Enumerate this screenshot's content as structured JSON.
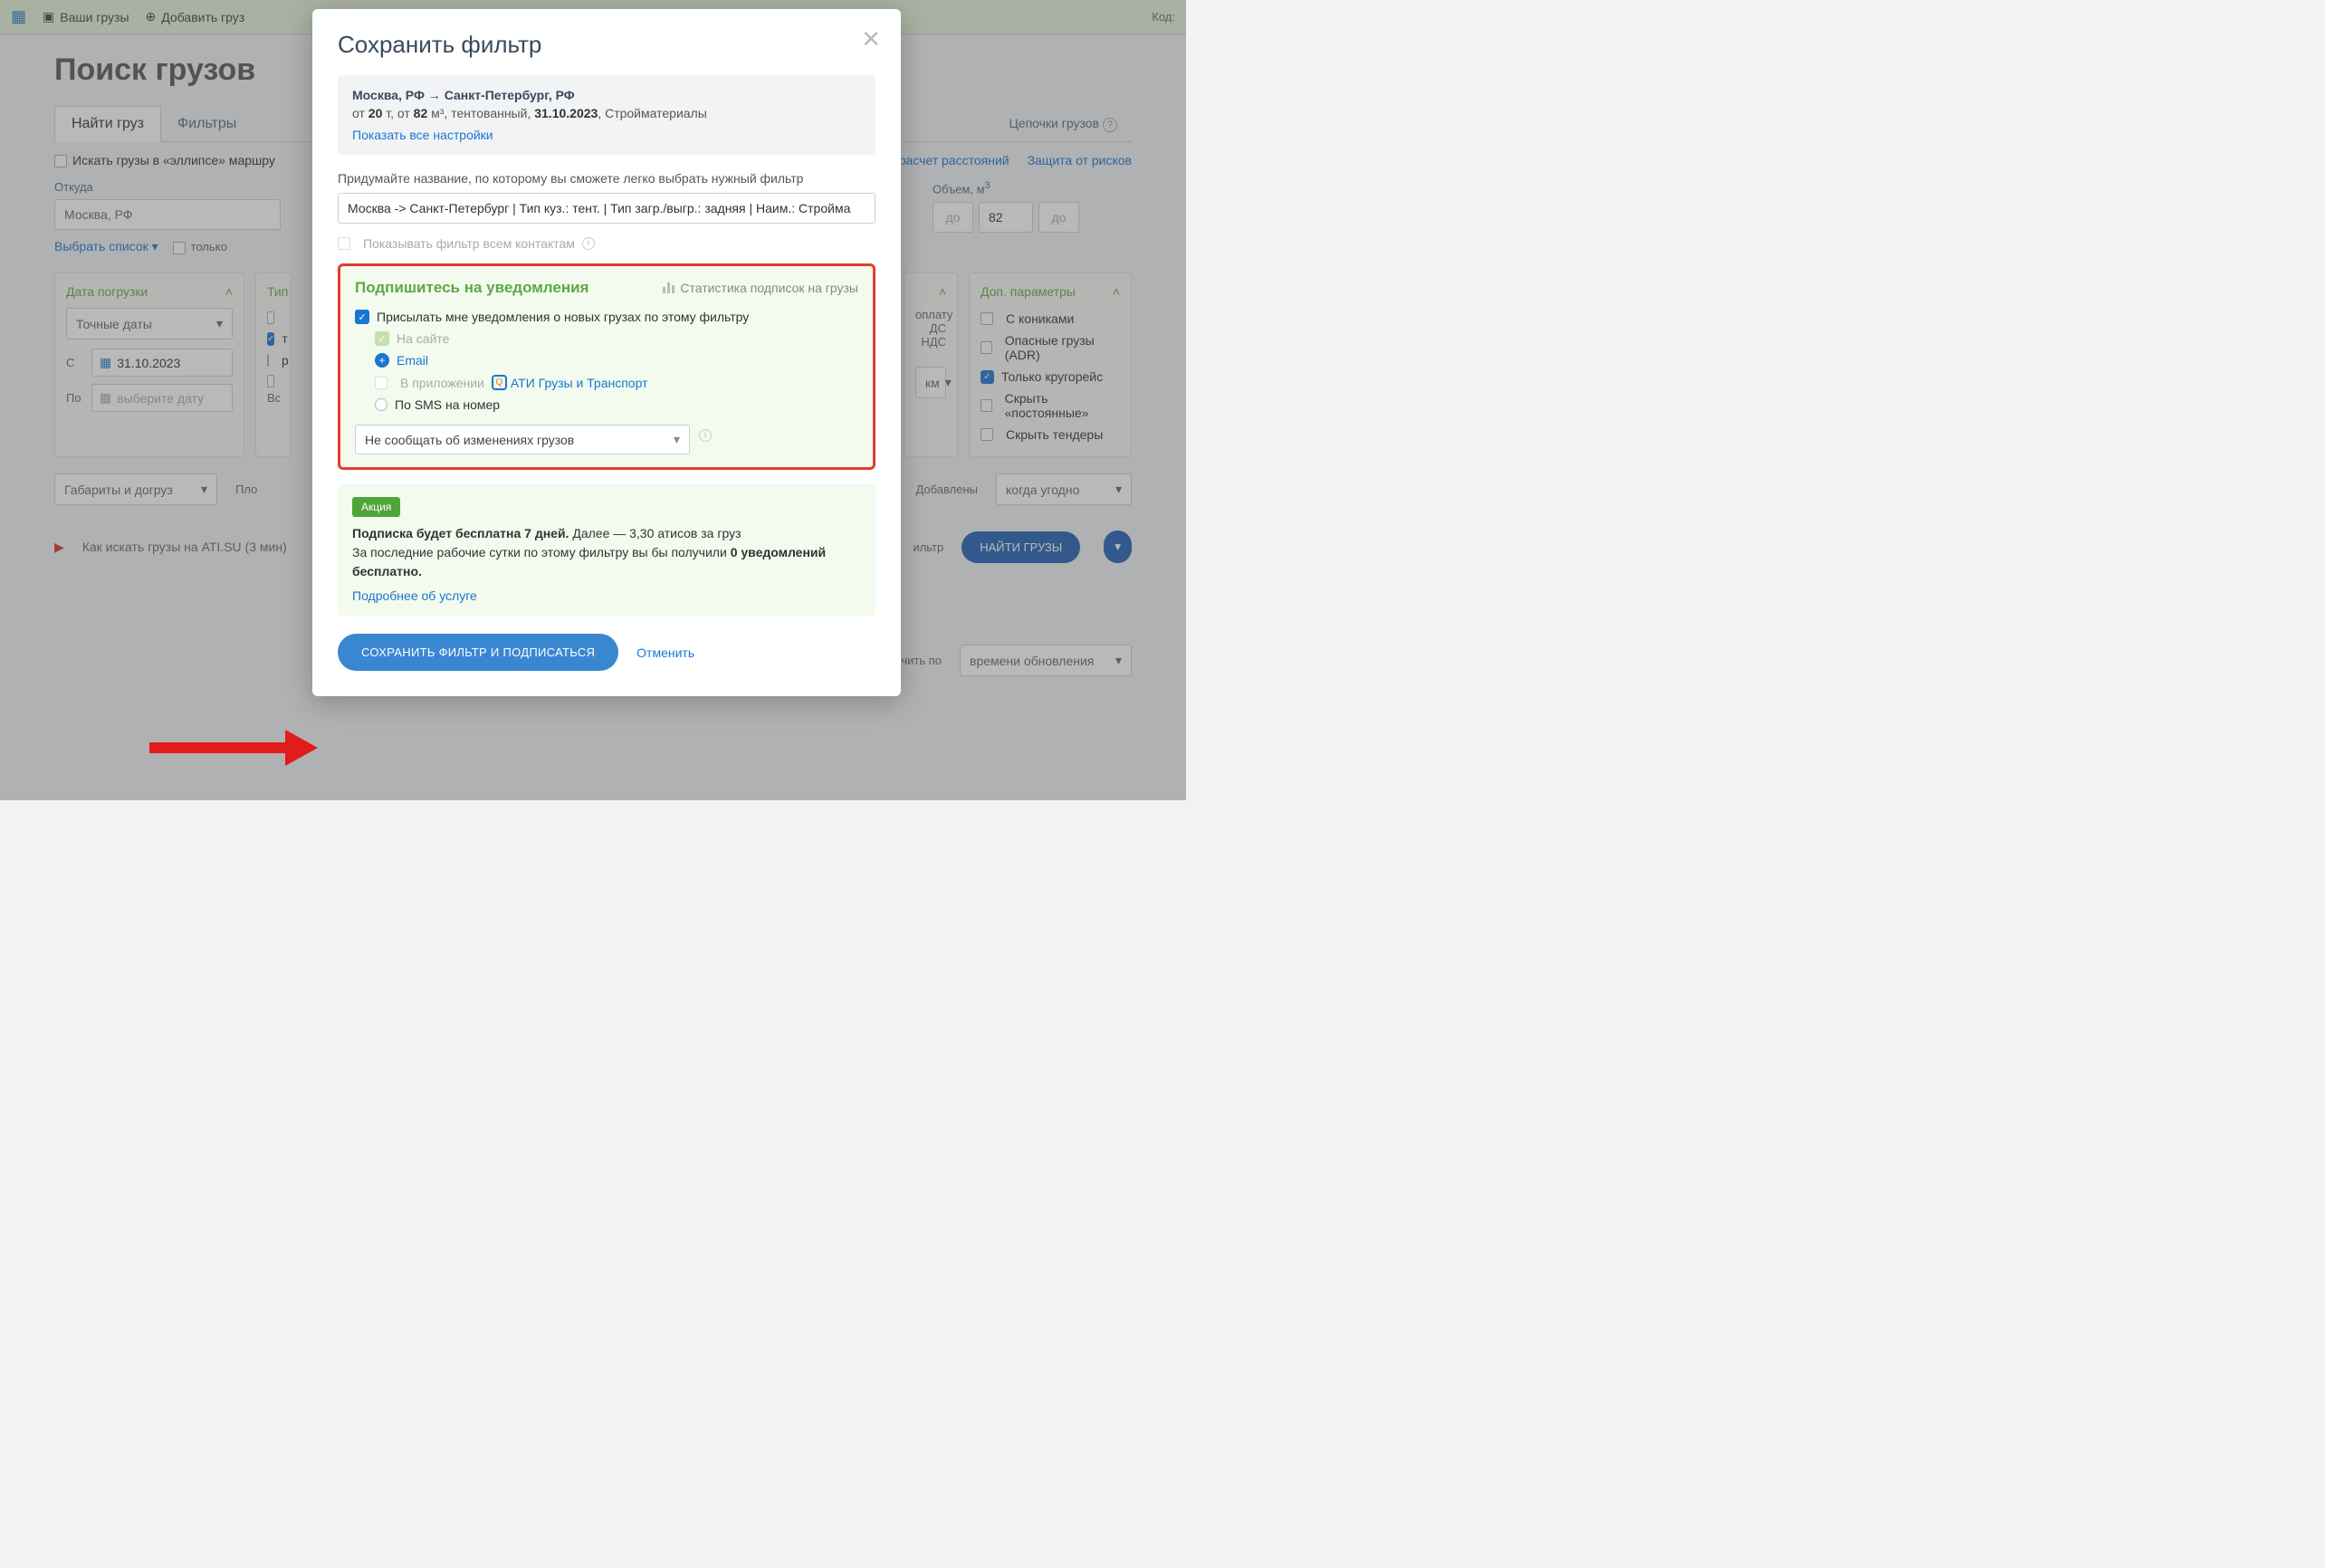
{
  "topbar": {
    "your_loads": "Ваши грузы",
    "add_load": "Добавить груз",
    "code_label": "Код:"
  },
  "page": {
    "title": "Поиск грузов",
    "tabs": {
      "find": "Найти груз",
      "filters": "Фильтры"
    },
    "chains_tab": "Цепочки грузов",
    "ellipse_search": "Искать грузы в «эллипсе» маршру",
    "distance_calc": "расчет расстояний",
    "risk_protection": "Защита от рисков",
    "from_label": "Откуда",
    "from_value": "Москва, РФ",
    "choose_list": "Выбрать список",
    "only": "только",
    "volume_label": "Объем, м",
    "volume_from": "82",
    "volume_to": "до",
    "km_to": "до",
    "km_unit": "км",
    "loading_date": {
      "title": "Дата погрузки",
      "exact": "Точные даты",
      "from": "С",
      "from_date": "31.10.2023",
      "to": "По",
      "to_placeholder": "выберите дату"
    },
    "body_type": {
      "title": "Тип",
      "item_t": "т",
      "item_r": "р",
      "all": "Вс"
    },
    "extra_params": {
      "title": "Доп. параметры",
      "with_koniki": "С кониками",
      "adr": "Опасные грузы (ADR)",
      "round_trip": "Только кругорейс",
      "hide_const": "Скрыть «постоянные»",
      "hide_tenders": "Скрыть тендеры"
    },
    "payment_side": {
      "oplatu": "оплату",
      "ds": "ДС",
      "nds": "НДС"
    },
    "dims": "Габариты и догруз",
    "plo": "Пло",
    "added_label": "Добавлены",
    "added_value": "когда угодно",
    "howto": "Как искать грузы на ATI.SU (3 мин)",
    "filter_right": "ильтр",
    "find_btn": "НАЙТИ ГРУЗЫ",
    "sort_by": "дочить по",
    "sort_value": "времени обновления"
  },
  "modal": {
    "title": "Сохранить фильтр",
    "route": "Москва, РФ → Санкт-Петербург, РФ",
    "detail_from": "от",
    "detail_weight": "20",
    "detail_t": "т,",
    "detail_from2": "от",
    "detail_vol": "82",
    "detail_m3": "м³,",
    "detail_body": "тентованный,",
    "detail_date": "31.10.2023",
    "detail_cargo": ", Стройматериалы",
    "show_all": "Показать все настройки",
    "hint": "Придумайте название, по которому вы сможете легко выбрать нужный фильтр",
    "name_value": "Москва -> Санкт-Петербург | Тип куз.: тент. | Тип загр./выгр.: задняя | Наим.: Стройма",
    "show_contacts": "Показывать фильтр всем контактам",
    "subscribe": {
      "title": "Подпишитесь на уведомления",
      "stat_link": "Статистика подписок на грузы",
      "send_me": "Присылать мне уведомления о новых грузах по этому фильтру",
      "on_site": "На сайте",
      "email": "Email",
      "in_app": "В приложении",
      "app_name": "АТИ Грузы и Транспорт",
      "sms": "По SMS на номер",
      "change_notify": "Не сообщать об изменениях грузов"
    },
    "promo": {
      "badge": "Акция",
      "line1a": "Подписка будет бесплатна 7 дней.",
      "line1b": " Далее — 3,30 атисов за груз",
      "line2a": "За последние рабочие сутки по этому фильтру вы бы получили ",
      "line2b": "0 уведомлений бесплатно.",
      "more": "Подробнее об услуге"
    },
    "save_btn": "СОХРАНИТЬ ФИЛЬТР И ПОДПИСАТЬСЯ",
    "cancel": "Отменить"
  }
}
